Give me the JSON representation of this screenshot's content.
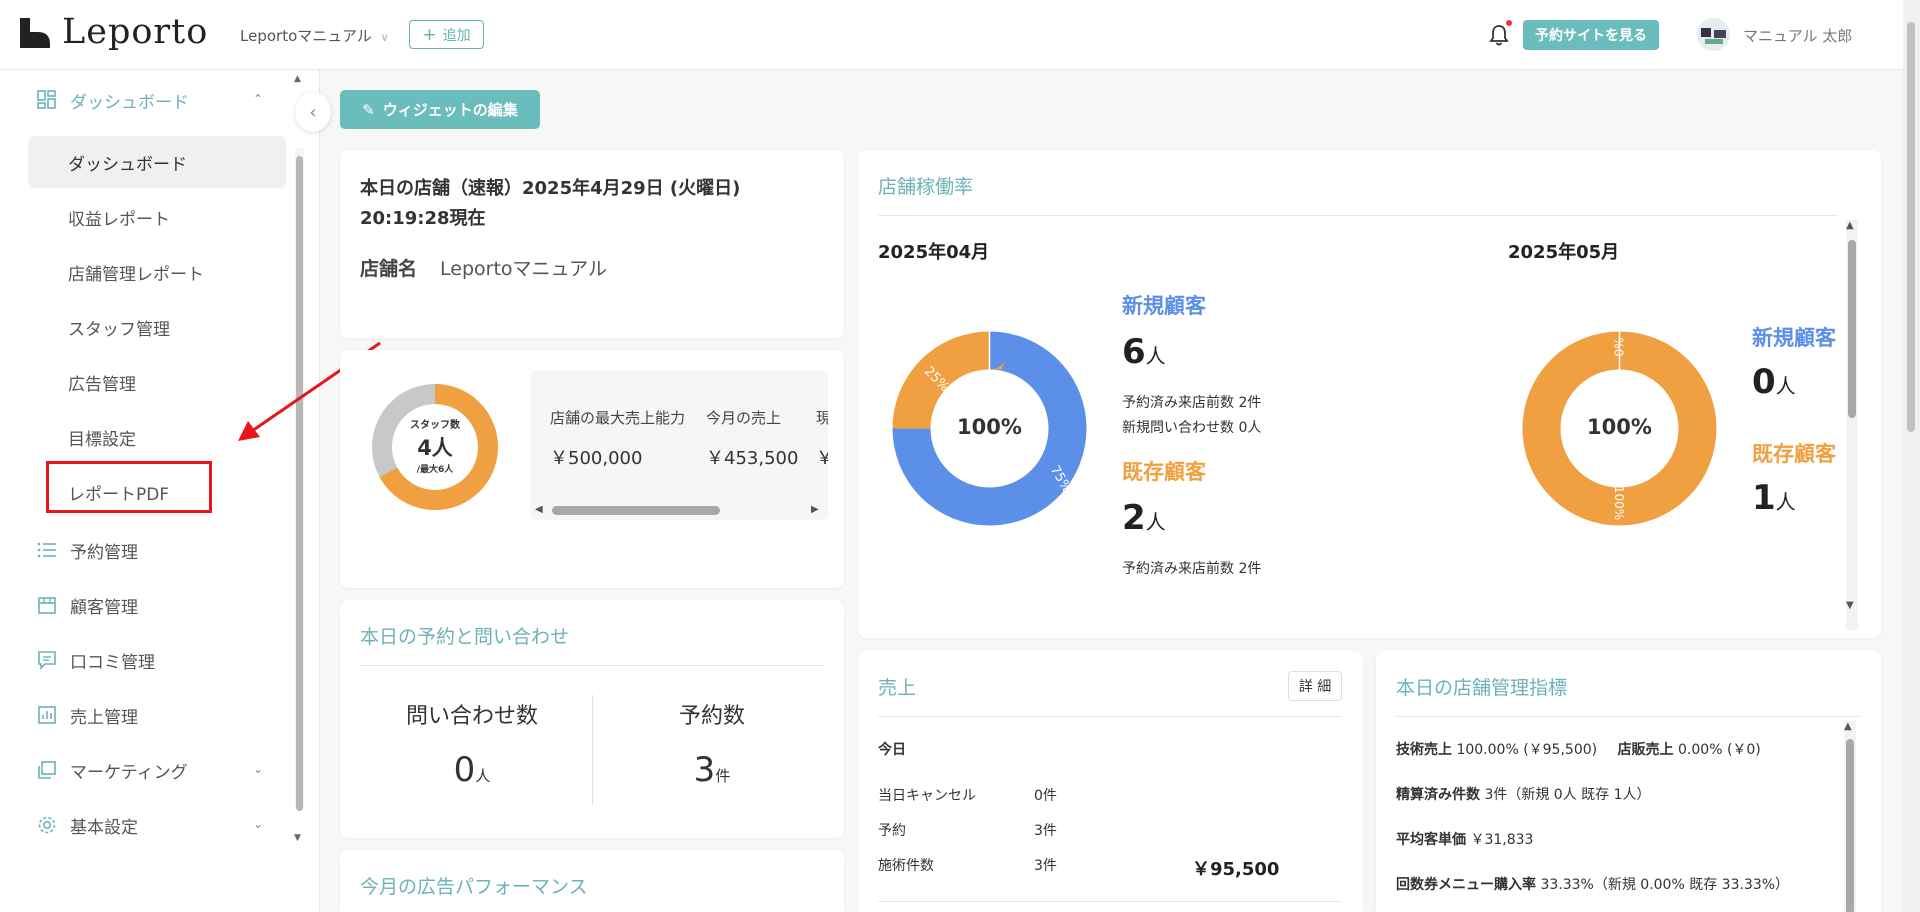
{
  "header": {
    "logo": "Leporto",
    "store_selector": "Leportoマニュアル",
    "add_label": "追加",
    "reserve_site_label": "予約サイトを見る",
    "user_name": "マニュアル 太郎"
  },
  "sidebar": {
    "dashboard_label": "ダッシュボード",
    "sub": [
      "ダッシュボード",
      "収益レポート",
      "店舗管理レポート",
      "スタッフ管理",
      "広告管理",
      "目標設定",
      "レポートPDF"
    ],
    "items": [
      "予約管理",
      "顧客管理",
      "口コミ管理",
      "売上管理",
      "マーケティング",
      "基本設定"
    ]
  },
  "toolbar": {
    "edit_widget_label": "ウィジェットの編集"
  },
  "today_card": {
    "title_line1": "本日の店舗（速報）2025年4月29日 (火曜日)",
    "title_line2": "20:19:28現在",
    "store_label": "店舗名",
    "store_name": "Leportoマニュアル"
  },
  "staff_card": {
    "donut_label": "スタッフ数",
    "donut_value": "4人",
    "donut_sub": "/最大6人",
    "staff_fraction": 0.67,
    "col1_label": "店舗の最大売上能力",
    "col1_value": "￥500,000",
    "col2_label": "今月の売上",
    "col2_value": "￥453,500",
    "col3_label": "現",
    "col3_value": "￥"
  },
  "inquiry_card": {
    "title": "本日の予約と問い合わせ",
    "inquiry_label": "問い合わせ数",
    "inquiry_value": "0",
    "inquiry_unit": "人",
    "reserve_label": "予約数",
    "reserve_value": "3",
    "reserve_unit": "件"
  },
  "ad_card": {
    "title": "今月の広告パフォーマンス"
  },
  "occupancy": {
    "title": "店舗稼働率",
    "months": [
      {
        "month": "2025年04月",
        "center": "100%",
        "new_label": "新規顧客",
        "new_value": "6",
        "unit": "人",
        "new_note1": "予約済み来店前数 2件",
        "new_note2": "新規問い合わせ数 0人",
        "exist_label": "既存顧客",
        "exist_value": "2",
        "exist_note": "予約済み来店前数 2件",
        "slice_new": "75%",
        "slice_exist": "25%"
      },
      {
        "month": "2025年05月",
        "center": "100%",
        "new_label": "新規顧客",
        "new_value": "0",
        "unit": "人",
        "exist_label": "既存顧客",
        "exist_value": "1",
        "slice_new": "0%",
        "slice_exist": "100%"
      }
    ]
  },
  "chart_data": [
    {
      "type": "pie",
      "title": "2025年04月",
      "categories": [
        "新規顧客",
        "既存顧客"
      ],
      "values": [
        75,
        25
      ],
      "colors": [
        "#5b8fe8",
        "#f0a040"
      ]
    },
    {
      "type": "pie",
      "title": "2025年05月",
      "categories": [
        "新規顧客",
        "既存顧客"
      ],
      "values": [
        0,
        100
      ],
      "colors": [
        "#5b8fe8",
        "#f0a040"
      ]
    }
  ],
  "sales_card": {
    "title": "売上",
    "detail_label": "詳 細",
    "today_label": "今日",
    "rows": [
      {
        "label": "当日キャンセル",
        "value": "0件"
      },
      {
        "label": "予約",
        "value": "3件"
      },
      {
        "label": "施術件数",
        "value": "3件"
      }
    ],
    "total": "￥95,500"
  },
  "metrics_card": {
    "title": "本日の店舗管理指標",
    "l1a": "技術売上",
    "v1a": "100.00% (￥95,500)",
    "l1b": "店販売上",
    "v1b": "0.00% (￥0)",
    "l2": "精算済み件数",
    "v2": "3件（新規 0人 既存 1人）",
    "l3": "平均客単価",
    "v3": "￥31,833",
    "l4": "回数券メニュー購入率",
    "v4": "33.33%（新規 0.00% 既存 33.33%）"
  },
  "colors": {
    "accent": "#6bbdbd",
    "new": "#5b8fe8",
    "existing": "#f0a040",
    "annotation": "#e8161b"
  }
}
